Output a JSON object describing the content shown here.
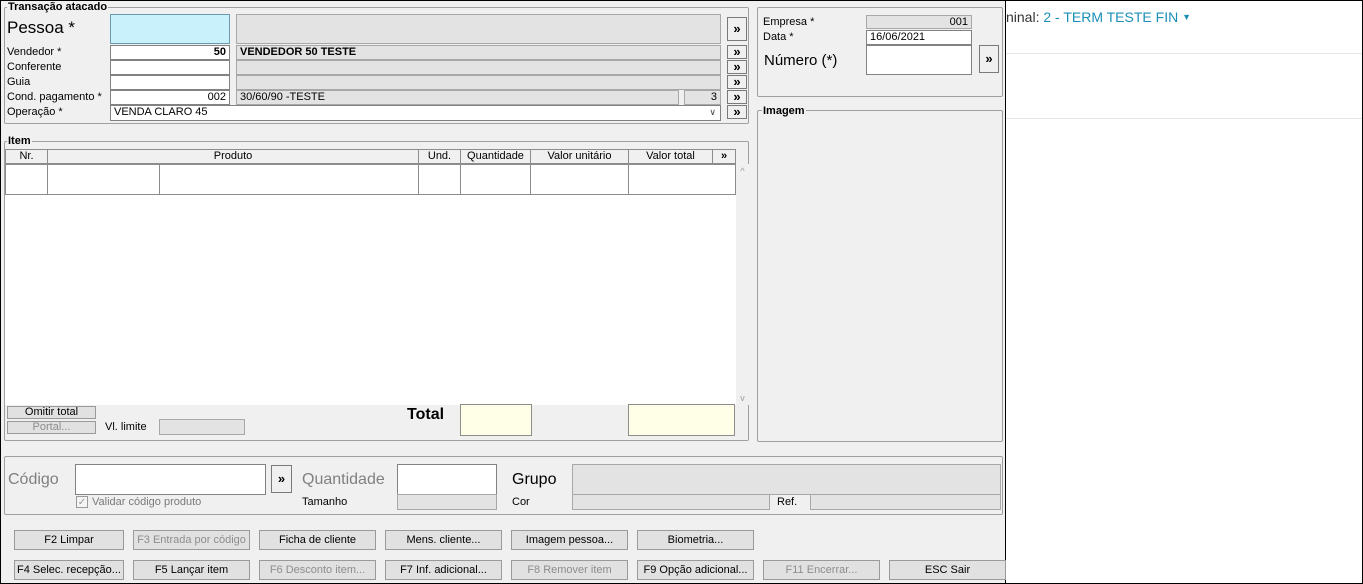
{
  "terminal": {
    "prefix": "ninal:",
    "name": "2 - TERM TESTE FIN"
  },
  "transacao": {
    "title": "Transação atacado",
    "pessoa_label": "Pessoa *",
    "vendedor_label": "Vendedor *",
    "vendedor_code": "50",
    "vendedor_name": "VENDEDOR 50 TESTE",
    "conferente_label": "Conferente",
    "guia_label": "Guia",
    "cond_label": "Cond. pagamento *",
    "cond_code": "002",
    "cond_desc": "30/60/90 -TESTE",
    "cond_parcelas": "3",
    "operacao_label": "Operação *",
    "operacao_value": "VENDA CLARO 45",
    "more": "»"
  },
  "header_right": {
    "empresa_label": "Empresa *",
    "empresa_value": "001",
    "data_label": "Data *",
    "data_value": "16/06/2021",
    "numero_label": "Número (*)"
  },
  "imagem_title": "Imagem",
  "item": {
    "title": "Item",
    "columns": [
      "Nr.",
      "Produto",
      "Und.",
      "Quantidade",
      "Valor unitário",
      "Valor total",
      "»"
    ],
    "scroll_up": "^",
    "scroll_down": "v"
  },
  "totals": {
    "omitir_label": "Omitir total",
    "portal_label": "Portal...",
    "vl_limite_label": "Vl. limite",
    "total_label": "Total"
  },
  "entry": {
    "codigo_label": "Código",
    "validar_label": "Validar código produto",
    "quantidade_label": "Quantidade",
    "tamanho_label": "Tamanho",
    "grupo_label": "Grupo",
    "cor_label": "Cor",
    "ref_label": "Ref."
  },
  "buttons_row1": [
    {
      "label": "F2 Limpar",
      "enabled": true
    },
    {
      "label": "F3 Entrada por código",
      "enabled": false
    },
    {
      "label": "Ficha de cliente",
      "enabled": true
    },
    {
      "label": "Mens. cliente...",
      "enabled": true
    },
    {
      "label": "Imagem pessoa...",
      "enabled": true
    },
    {
      "label": "Biometria...",
      "enabled": true
    }
  ],
  "buttons_row2": [
    {
      "label": "F4 Selec. recepção...",
      "enabled": true
    },
    {
      "label": "F5 Lançar item",
      "enabled": true
    },
    {
      "label": "F6 Desconto item...",
      "enabled": false
    },
    {
      "label": "F7 Inf. adicional...",
      "enabled": true
    },
    {
      "label": "F8 Remover item",
      "enabled": false
    },
    {
      "label": "F9 Opção adicional...",
      "enabled": true
    },
    {
      "label": "F11 Encerrar...",
      "enabled": false
    },
    {
      "label": "ESC Sair",
      "enabled": true
    }
  ],
  "colors": {
    "accent": "#1a8fb8",
    "pessoa_bg": "#c9f1fb",
    "total_bg": "#ffffe8"
  }
}
